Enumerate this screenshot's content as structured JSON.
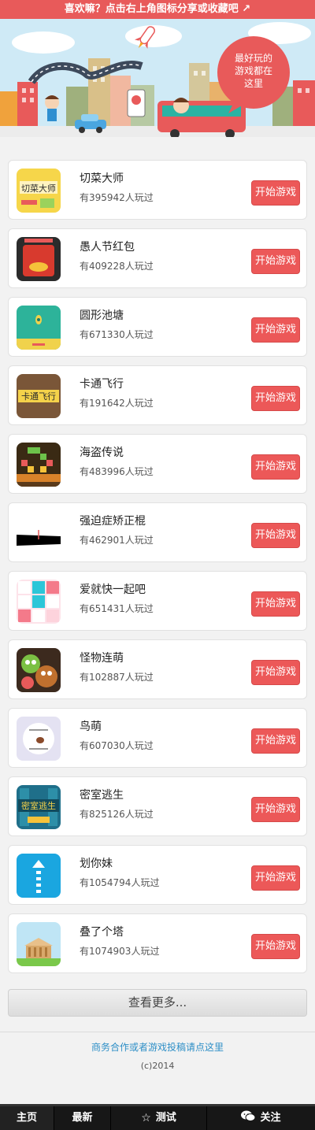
{
  "banner": {
    "text": "喜欢嘛？点击右上角图标分享或收藏吧 ↗"
  },
  "hero": {
    "sign_line1": "最好玩的",
    "sign_line2": "游戏都在",
    "sign_line3": "这里"
  },
  "games": [
    {
      "name": "切菜大师",
      "plays": "有395942人玩过",
      "button": "开始游戏",
      "thumb_text": "切菜大师"
    },
    {
      "name": "愚人节红包",
      "plays": "有409228人玩过",
      "button": "开始游戏",
      "thumb_text": ""
    },
    {
      "name": "圆形池塘",
      "plays": "有671330人玩过",
      "button": "开始游戏",
      "thumb_text": ""
    },
    {
      "name": "卡通飞行",
      "plays": "有191642人玩过",
      "button": "开始游戏",
      "thumb_text": "卡通飞行"
    },
    {
      "name": "海盗传说",
      "plays": "有483996人玩过",
      "button": "开始游戏",
      "thumb_text": ""
    },
    {
      "name": "强迫症矫正棍",
      "plays": "有462901人玩过",
      "button": "开始游戏",
      "thumb_text": ""
    },
    {
      "name": "爱就快一起吧",
      "plays": "有651431人玩过",
      "button": "开始游戏",
      "thumb_text": ""
    },
    {
      "name": "怪物连萌",
      "plays": "有102887人玩过",
      "button": "开始游戏",
      "thumb_text": ""
    },
    {
      "name": "鸟萌",
      "plays": "有607030人玩过",
      "button": "开始游戏",
      "thumb_text": ""
    },
    {
      "name": "密室逃生",
      "plays": "有825126人玩过",
      "button": "开始游戏",
      "thumb_text": "密室逃生"
    },
    {
      "name": "划你妹",
      "plays": "有1054794人玩过",
      "button": "开始游戏",
      "thumb_text": ""
    },
    {
      "name": "叠了个塔",
      "plays": "有1074903人玩过",
      "button": "开始游戏",
      "thumb_text": ""
    }
  ],
  "more_button": "查看更多...",
  "footer": {
    "link": "商务合作或者游戏投稿请点这里",
    "copyright": "(c)2014"
  },
  "nav": {
    "home": "主页",
    "latest": "最新",
    "test": "测试",
    "follow": "关注",
    "test_icon": "star-icon",
    "follow_icon": "wechat-icon"
  },
  "colors": {
    "accent": "#ec5858",
    "nav_bg": "#171717",
    "link": "#2e8fc7"
  }
}
